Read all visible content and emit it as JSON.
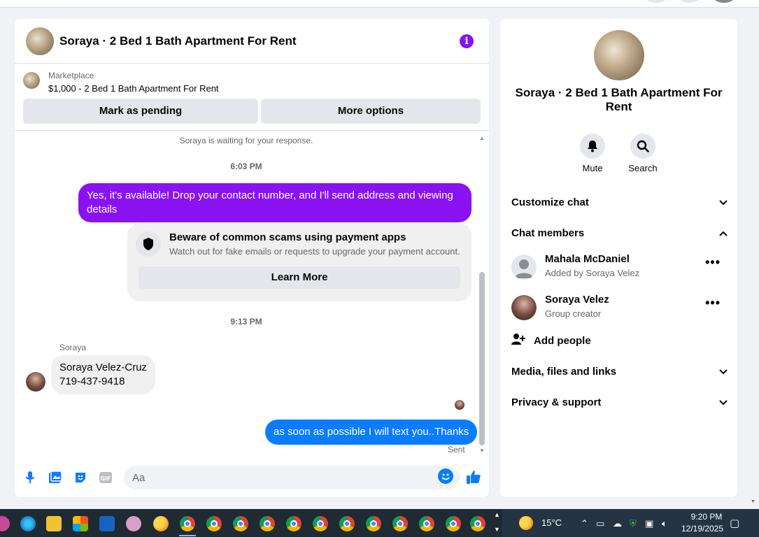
{
  "chat": {
    "title": "Soraya · 2 Bed 1 Bath Apartment For Rent",
    "listing_source": "Marketplace",
    "listing_price": "$1,000 - 2 Bed 1 Bath Apartment For Rent",
    "mark_pending_label": "Mark as pending",
    "more_options_label": "More options",
    "waiting_text": "Soraya is waiting for your response.",
    "time1": "6:03 PM",
    "msg_out1": "Yes, it's available! Drop your contact number, and I'll send address and viewing details",
    "scam_title": "Beware of common scams using payment apps",
    "scam_sub": "Watch out for fake emails or requests to upgrade your payment account.",
    "learn_more": "Learn More",
    "time2": "9:13 PM",
    "sender_name": "Soraya",
    "msg_in1_line1": "Soraya Velez-Cruz",
    "msg_in1_line2": "719-437-9418",
    "msg_out2": "as soon as possible I will text you..Thanks",
    "sent_label": "Sent",
    "input_placeholder": "Aa"
  },
  "side": {
    "title": "Soraya · 2 Bed 1 Bath Apartment For Rent",
    "mute_label": "Mute",
    "search_label": "Search",
    "sections": {
      "customize": "Customize chat",
      "members": "Chat members",
      "media": "Media, files and links",
      "privacy": "Privacy & support"
    },
    "members": [
      {
        "name": "Mahala McDaniel",
        "sub": "Added by Soraya Velez"
      },
      {
        "name": "Soraya Velez",
        "sub": "Group creator"
      }
    ],
    "add_people": "Add people"
  },
  "taskbar": {
    "weather": "15°C",
    "time": "9:20 PM",
    "date": "12/19/2025"
  },
  "colors": {
    "accent_purple": "#8a12f0",
    "accent_blue": "#0a7cff"
  }
}
